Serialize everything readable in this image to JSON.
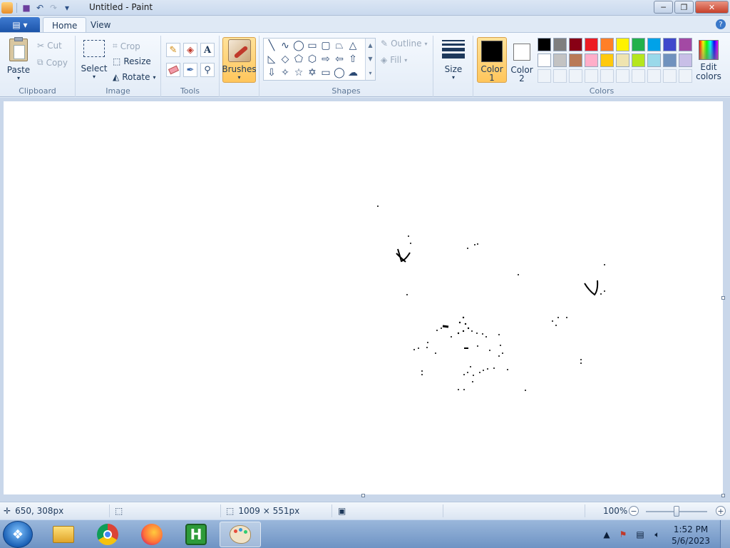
{
  "window": {
    "title": "Untitled - Paint",
    "min": "─",
    "max": "❐",
    "close": "✕"
  },
  "qat": {
    "save_icon": "■",
    "undo_icon": "↶",
    "redo_icon": "↷",
    "dropdown_icon": "▾"
  },
  "tabs": {
    "app_menu": "▤ ▾",
    "home": "Home",
    "view": "View",
    "help": "?"
  },
  "clipboard": {
    "paste": "Paste",
    "cut": "Cut",
    "copy": "Copy",
    "label": "Clipboard"
  },
  "image": {
    "select": "Select",
    "crop": "Crop",
    "resize": "Resize",
    "rotate": "Rotate",
    "label": "Image"
  },
  "tools": {
    "label": "Tools",
    "text_tool": "A"
  },
  "brushes": {
    "label": "Brushes"
  },
  "shapes": {
    "outline": "Outline",
    "fill": "Fill",
    "label": "Shapes"
  },
  "size": {
    "label": "Size"
  },
  "colors": {
    "color1_label": "Color",
    "color1_num": "1",
    "color2_label": "Color",
    "color2_num": "2",
    "edit": "Edit",
    "edit2": "colors",
    "label": "Colors",
    "color1": "#000000",
    "color2": "#ffffff",
    "palette_row1": [
      "#000000",
      "#7f7f7f",
      "#880015",
      "#ed1c24",
      "#ff7f27",
      "#fff200",
      "#22b14c",
      "#00a2e8",
      "#3f48cc",
      "#a349a4"
    ],
    "palette_row2": [
      "#ffffff",
      "#c3c3c3",
      "#b97a57",
      "#ffaec9",
      "#ffc90e",
      "#efe4b0",
      "#b5e61d",
      "#99d9ea",
      "#7092be",
      "#c8bfe7"
    ]
  },
  "status": {
    "cursor_pos": "650, 308px",
    "selection_size": "",
    "canvas_size": "1009 × 551px",
    "zoom": "100%",
    "zoom_out": "−",
    "zoom_in": "+"
  },
  "taskbar": {
    "start_icon": "❖",
    "time": "1:52 PM",
    "date": "5/6/2023",
    "hiliter_letter": "H",
    "tray_arrow": "▲"
  }
}
